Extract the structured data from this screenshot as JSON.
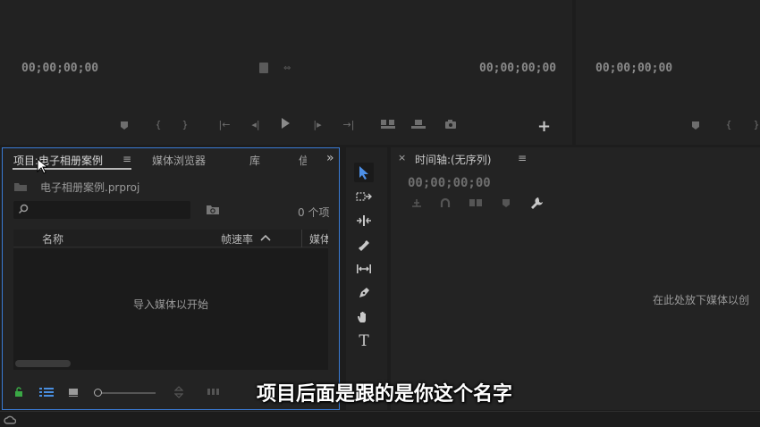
{
  "source_monitor": {
    "timecode_left": "00;00;00;00",
    "timecode_right": "00;00;00;00"
  },
  "program_monitor": {
    "timecode_left": "00;00;00;00"
  },
  "project_panel": {
    "tab_project": "项目:电子相册案例",
    "menu_glyph": "≡",
    "tab_media_browser": "媒体浏览器",
    "tab_library": "库",
    "tab_info": "信",
    "overflow": "»",
    "file_name": "电子相册案例.prproj",
    "search_placeholder": "",
    "item_count": "0 个项",
    "col_name": "名称",
    "col_framerate": "帧速率",
    "col_media": "媒体",
    "empty_hint": "导入媒体以开始"
  },
  "timeline_panel": {
    "close": "×",
    "title": "时间轴:(无序列)",
    "menu_glyph": "≡",
    "timecode": "00;00;00;00",
    "drop_hint": "在此处放下媒体以创"
  },
  "tools": {
    "type_tool": "T"
  },
  "add_button": "+",
  "subtitle": "项目后面是跟的是你这个名字"
}
